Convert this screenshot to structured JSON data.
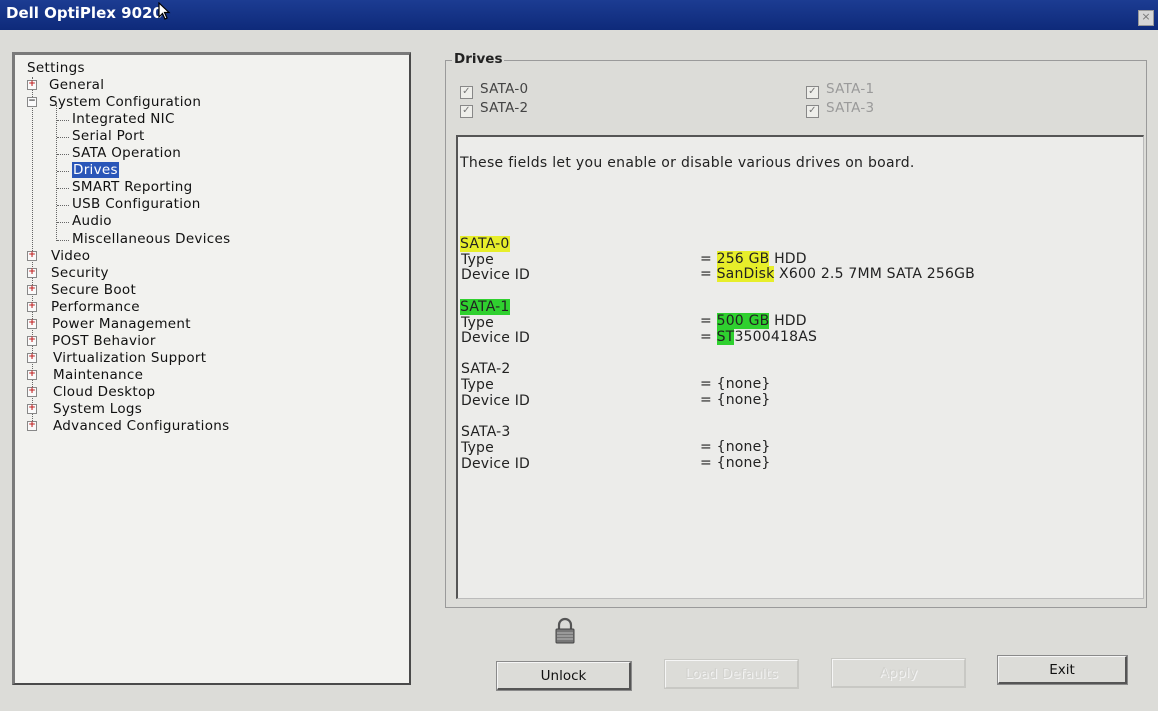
{
  "window": {
    "title": "Dell OptiPlex 9020"
  },
  "tree": {
    "root": "Settings",
    "items": [
      {
        "label": "General",
        "expandable": true
      },
      {
        "label": "System Configuration",
        "expandable": true
      },
      {
        "label": "Integrated NIC"
      },
      {
        "label": "Serial Port"
      },
      {
        "label": "SATA Operation"
      },
      {
        "label": "Drives",
        "selected": true
      },
      {
        "label": "SMART Reporting"
      },
      {
        "label": "USB Configuration"
      },
      {
        "label": "Audio"
      },
      {
        "label": "Miscellaneous Devices"
      },
      {
        "label": "Video",
        "expandable": true
      },
      {
        "label": "Security",
        "expandable": true
      },
      {
        "label": "Secure Boot",
        "expandable": true
      },
      {
        "label": "Performance",
        "expandable": true
      },
      {
        "label": "Power Management",
        "expandable": true
      },
      {
        "label": "POST Behavior",
        "expandable": true
      },
      {
        "label": "Virtualization Support",
        "expandable": true
      },
      {
        "label": "Maintenance",
        "expandable": true
      },
      {
        "label": "Cloud Desktop",
        "expandable": true
      },
      {
        "label": "System Logs",
        "expandable": true
      },
      {
        "label": "Advanced Configurations",
        "expandable": true
      }
    ]
  },
  "drives": {
    "legend": "Drives",
    "checkboxes": [
      {
        "label": "SATA-0",
        "checked": true,
        "enabled": true
      },
      {
        "label": "SATA-1",
        "checked": true,
        "enabled": false
      },
      {
        "label": "SATA-2",
        "checked": true,
        "enabled": true
      },
      {
        "label": "SATA-3",
        "checked": true,
        "enabled": false
      }
    ],
    "description": "These fields let you enable or disable various drives on board.",
    "field_labels": {
      "type": "Type",
      "device_id": "Device ID"
    },
    "entries": [
      {
        "name": "SATA-0",
        "type_hl": "256 GB",
        "type_rest": " HDD",
        "id_hl": "SanDisk",
        "id_rest": " X600 2.5 7MM SATA 256GB"
      },
      {
        "name": "SATA-1",
        "type_hl": "500 GB",
        "type_rest": " HDD",
        "id_hl": "ST",
        "id_rest": "3500418AS"
      },
      {
        "name": "SATA-2",
        "type": "{none}",
        "id": "{none}"
      },
      {
        "name": "SATA-3",
        "type": "{none}",
        "id": "{none}"
      }
    ],
    "equals": "= "
  },
  "buttons": {
    "unlock": "Unlock",
    "load_defaults": "Load Defaults",
    "apply": "Apply",
    "exit": "Exit"
  },
  "colors": {
    "title_bar": "#1c3c92",
    "selection": "#2a56b8",
    "highlight_yellow": "#e7ee2a",
    "highlight_green": "#2fd02f"
  },
  "icons": {
    "lock": "lock-icon",
    "cursor": "mouse-cursor-icon"
  }
}
